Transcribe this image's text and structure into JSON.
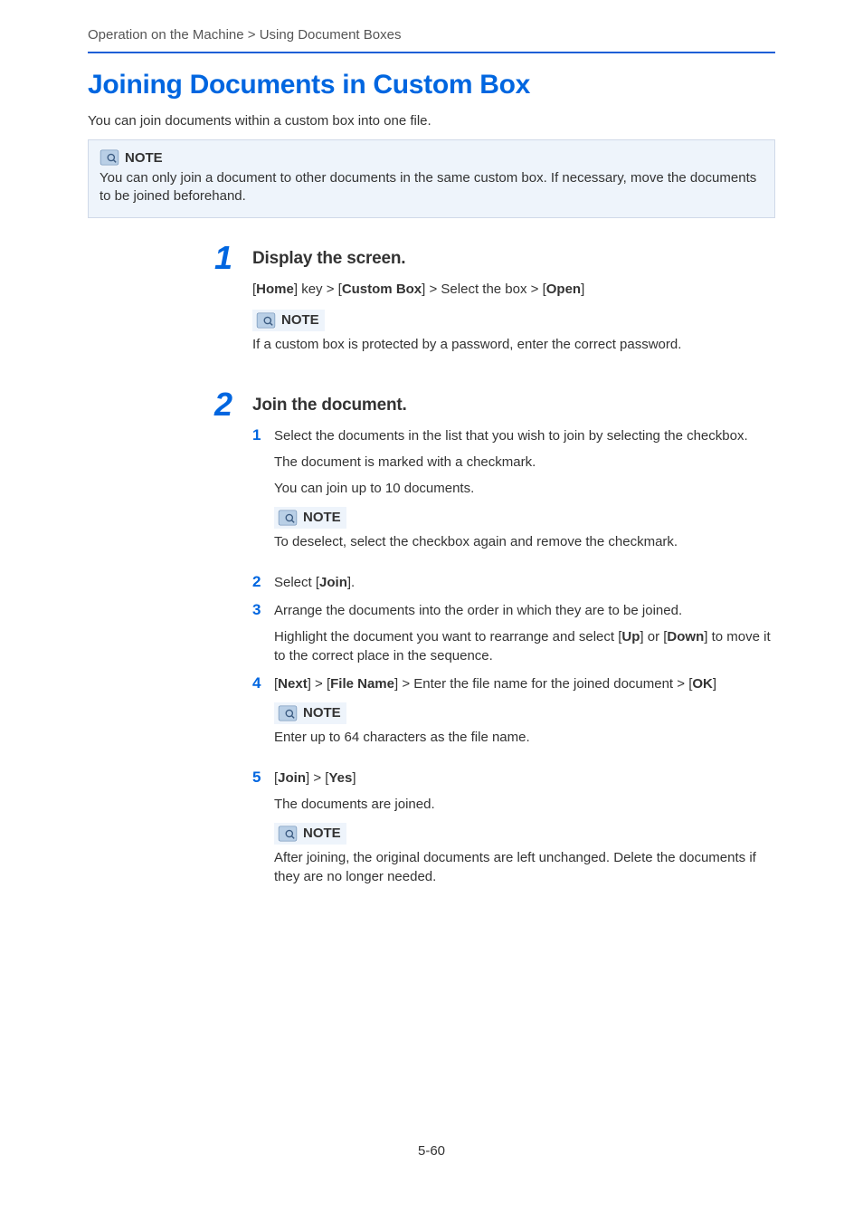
{
  "breadcrumb": "Operation on the Machine > Using Document Boxes",
  "title": "Joining Documents in Custom Box",
  "intro": "You can join documents within a custom box into one file.",
  "outerNote": {
    "label": "NOTE",
    "body": "You can only join a document to other documents in the same custom box. If necessary, move the documents to be joined beforehand."
  },
  "step1": {
    "num": "1",
    "heading": "Display the screen.",
    "nav": {
      "p1": "[",
      "b1": "Home",
      "p2": "] key > [",
      "b2": "Custom Box",
      "p3": "] > Select the box > [",
      "b3": "Open",
      "p4": "]"
    },
    "note": {
      "label": "NOTE",
      "body": "If a custom box is protected by a password, enter the correct password."
    }
  },
  "step2": {
    "num": "2",
    "heading": "Join the document.",
    "sub1": {
      "num": "1",
      "line1": "Select the documents in the list that you wish to join by selecting the checkbox.",
      "line2": "The document is marked with a checkmark.",
      "line3": "You can join up to 10 documents.",
      "note": {
        "label": "NOTE",
        "body": "To deselect, select the checkbox again and remove the checkmark."
      }
    },
    "sub2": {
      "num": "2",
      "line": {
        "p1": "Select [",
        "b1": "Join",
        "p2": "]."
      }
    },
    "sub3": {
      "num": "3",
      "line1": "Arrange the documents into the order in which they are to be joined.",
      "line2": {
        "p1": "Highlight the document you want to rearrange and select [",
        "b1": "Up",
        "p2": "] or [",
        "b2": "Down",
        "p3": "] to move it to the correct place in the sequence."
      }
    },
    "sub4": {
      "num": "4",
      "line": {
        "p1": "[",
        "b1": "Next",
        "p2": "] > [",
        "b2": "File Name",
        "p3": "] > Enter the file name for the joined document > [",
        "b3": "OK",
        "p4": "]"
      },
      "note": {
        "label": "NOTE",
        "body": "Enter up to 64 characters as the file name."
      }
    },
    "sub5": {
      "num": "5",
      "line1": {
        "p1": "[",
        "b1": "Join",
        "p2": "] > [",
        "b2": "Yes",
        "p3": "]"
      },
      "line2": "The documents are joined.",
      "note": {
        "label": "NOTE",
        "body": "After joining, the original documents are left unchanged. Delete the documents if they are no longer needed."
      }
    }
  },
  "pageNumber": "5-60"
}
